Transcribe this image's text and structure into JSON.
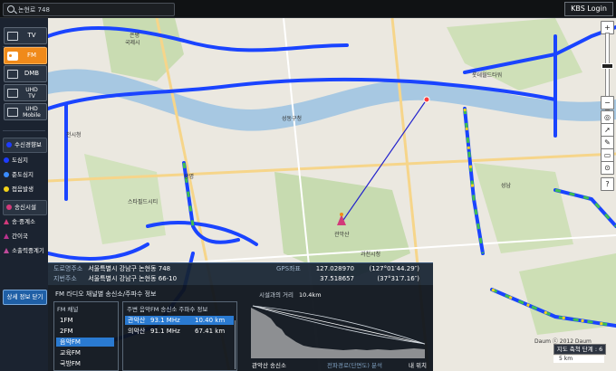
{
  "search": {
    "value": "논현로 748"
  },
  "login_label": "KBS Login",
  "sidebar": {
    "media": [
      {
        "label": "TV",
        "icon": "tv-icon",
        "active": false
      },
      {
        "label": "FM",
        "icon": "radio-icon",
        "active": true
      },
      {
        "label": "DMB",
        "icon": "dmb-icon",
        "active": false
      },
      {
        "label": "UHD TV",
        "line1": "UHD",
        "line2": "TV",
        "icon": "uhd-tv-icon",
        "active": false
      },
      {
        "label": "UHD Mobile",
        "line1": "UHD",
        "line2": "Mobile",
        "icon": "uhd-mobile-icon",
        "active": false
      }
    ],
    "reception_header": "수신경향보",
    "reception_items": [
      {
        "label": "도심지",
        "color": "#1e3cff"
      },
      {
        "label": "준도심지",
        "color": "#3a8cff"
      },
      {
        "label": "접음발생",
        "color": "#f2d21a"
      }
    ],
    "transmitter_header": "송신시설",
    "transmitter_items": [
      {
        "label": "송·중계소",
        "color": "#d23a7a"
      },
      {
        "label": "간이국",
        "color": "#b9328e"
      },
      {
        "label": "소출력중계기",
        "color": "#c04a9a"
      }
    ],
    "close_label": "상세 정보 닫기"
  },
  "address": {
    "road_key": "도로명주소",
    "road_value": "서울특별시 강남구 논현동 748",
    "lot_key": "지번주소",
    "lot_value": "서울특별시 강남구 논현동 66-10",
    "gps_key": "GPS좌표",
    "gps_lon": "127.028970",
    "gps_lon_dms": "(127°01′44.29″)",
    "gps_lat": "37.518657",
    "gps_lat_dms": "(37°31′7.16″)"
  },
  "fm_panel": {
    "title": "FM 라디오 채널별 송신소/주파수 정보",
    "channel_header": "FM 채널",
    "channels": [
      "1FM",
      "2FM",
      "음악FM",
      "교육FM",
      "국방FM"
    ],
    "selected_channel": 2,
    "tx_header": "주변 음악FM 송신소 주파수 정보",
    "transmitters": [
      {
        "name": "관악산",
        "freq": "93.1 MHz",
        "dist": "10.40 km",
        "selected": true
      },
      {
        "name": "의악산",
        "freq": "91.1 MHz",
        "dist": "67.41 km",
        "selected": false
      }
    ],
    "distance_label": "시설과의 거리",
    "distance_value": "10.4km",
    "profile_left": "관악산 송신소",
    "profile_mid": "전파경로(단면도) 분석",
    "profile_right": "내 위치"
  },
  "map": {
    "labels": [
      {
        "text": "은평",
        "name": "label-eunpyeong"
      },
      {
        "text": "국제시",
        "name": "label-gukje"
      },
      {
        "text": "천시청",
        "name": "label-cheonsi"
      },
      {
        "text": "광명",
        "name": "label-gwangmyeong"
      },
      {
        "text": "성동구청",
        "name": "label-seongdong"
      },
      {
        "text": "관악산",
        "name": "label-gwanaksan"
      },
      {
        "text": "과천시청",
        "name": "label-gwacheon"
      },
      {
        "text": "롯데월드타워",
        "name": "label-lotte"
      },
      {
        "text": "스타필드시티",
        "name": "label-starfield"
      },
      {
        "text": "성남",
        "name": "label-seongnam"
      }
    ]
  },
  "scale": {
    "level": "지도 축척 단계 : 6",
    "left": "5 km",
    "right": ""
  },
  "copyright": "Daum ⓒ 2012 Daum"
}
